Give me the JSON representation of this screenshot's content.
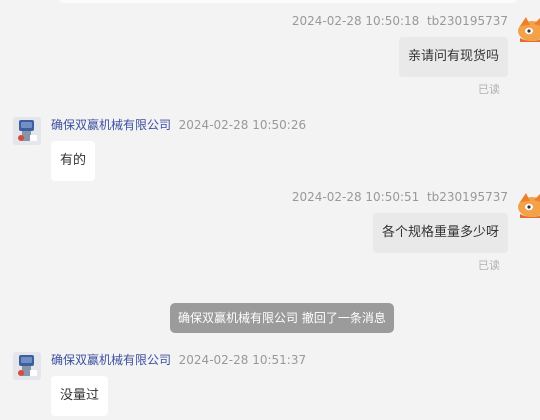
{
  "messages": [
    {
      "direction": "out",
      "timestamp": "2024-02-28 10:50:18",
      "sender": "tb230195737",
      "text": "亲请问有现货吗",
      "status": "已读"
    },
    {
      "direction": "in",
      "sender": "确保双赢机械有限公司",
      "timestamp": "2024-02-28 10:50:26",
      "text": "有的"
    },
    {
      "direction": "out",
      "timestamp": "2024-02-28 10:50:51",
      "sender": "tb230195737",
      "text": "各个规格重量多少呀",
      "status": "已读"
    },
    {
      "direction": "in",
      "sender": "确保双赢机械有限公司",
      "timestamp": "2024-02-28 10:51:37",
      "text": "没量过"
    }
  ],
  "system_notice": "确保双赢机械有限公司 撤回了一条消息",
  "colors": {
    "background": "#f3f3f3",
    "incoming_bubble": "#ffffff",
    "outgoing_bubble": "#e9e9e9",
    "sender_name": "#3d4fa0",
    "meta_text": "#999999",
    "notice_bg": "#9b9b9b"
  },
  "icons": {
    "customer_avatar": "orange-cartoon-avatar-icon",
    "seller_avatar": "product-thumbnail-avatar"
  }
}
